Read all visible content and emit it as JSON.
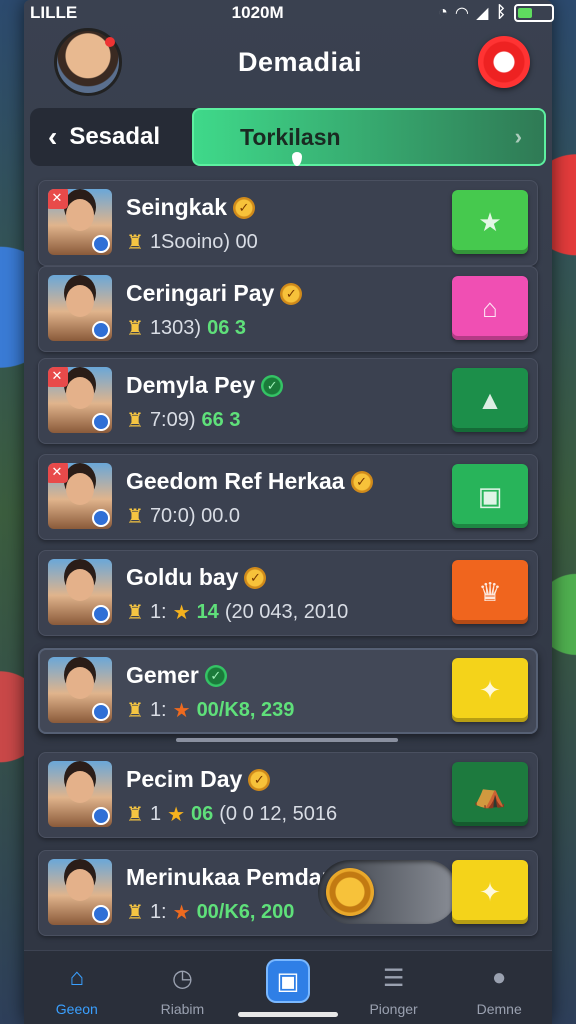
{
  "status_bar": {
    "carrier": "LILLE",
    "time": "1020M"
  },
  "header": {
    "title": "Demadiai"
  },
  "tabs": {
    "back_label": "Sesadal",
    "active_label": "Torkilasn"
  },
  "rows": [
    {
      "name": "Seingkak",
      "stats_text": "1Sooino) 00",
      "stats_highlight": "",
      "button_color": "#46c94e",
      "button_icon": "star-icon",
      "button_glyph": "★"
    },
    {
      "name": "Ceringari Pay",
      "stats_text": "1303)",
      "stats_highlight": "06 3",
      "button_color": "#f04fb3",
      "button_icon": "gift-icon",
      "button_glyph": "⌂"
    },
    {
      "name": "Demyla Pey",
      "stats_text": "7:09)",
      "stats_highlight": "66 3",
      "button_color": "#1c8f4a",
      "button_icon": "tree-icon",
      "button_glyph": "▲"
    },
    {
      "name": "Geedom Ref Herkaa",
      "stats_text": "70:0) 00.0",
      "stats_highlight": "",
      "button_color": "#28b45a",
      "button_icon": "box-icon",
      "button_glyph": "▣"
    },
    {
      "name": "Goldu bay",
      "stats_text": "1:",
      "stats_highlight": "14",
      "stats_tail": "(20 043, 2010",
      "button_color": "#f0651e",
      "button_icon": "trophy-icon",
      "button_glyph": "♛"
    },
    {
      "name": "Gemer",
      "stats_text": "1:",
      "stats_highlight": "00/K8, 239",
      "button_color": "#f4d31a",
      "button_icon": "chest-icon",
      "button_glyph": "✦"
    },
    {
      "name": "Pecim Day",
      "stats_text": "1",
      "stats_highlight": "06",
      "stats_tail": "(0 0 12, 5016",
      "button_color": "#1d7a3e",
      "button_icon": "tent-icon",
      "button_glyph": "⛺"
    },
    {
      "name": "Merinukaa Pemdan",
      "stats_text": "1:",
      "stats_highlight": "00/K6, 200",
      "button_color": "#f4d31a",
      "button_icon": "chest-icon",
      "button_glyph": "✦"
    }
  ],
  "bottom_nav": [
    {
      "label": "Geeon",
      "icon": "home-icon",
      "glyph": "⌂"
    },
    {
      "label": "Riabim",
      "icon": "clock-icon",
      "glyph": "◷"
    },
    {
      "label": "",
      "icon": "center-action-icon",
      "glyph": "▣"
    },
    {
      "label": "Pionger",
      "icon": "inbox-icon",
      "glyph": "☰"
    },
    {
      "label": "Demne",
      "icon": "profile-icon",
      "glyph": "●"
    }
  ]
}
